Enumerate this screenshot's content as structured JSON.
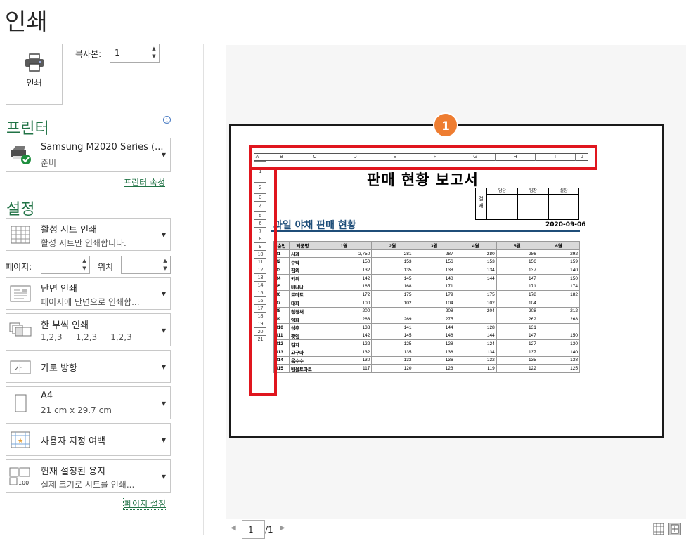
{
  "title": "인쇄",
  "print_button": {
    "label": "인쇄",
    "icon": "printer-icon"
  },
  "copies": {
    "label": "복사본:",
    "value": "1"
  },
  "printer_section": {
    "heading": "프린터",
    "info_icon": "info-icon"
  },
  "printer": {
    "name": "Samsung M2020 Series (...",
    "status": "준비",
    "properties_link": "프린터 속성"
  },
  "settings_section": {
    "heading": "설정"
  },
  "settings": [
    {
      "icon": "sheet-grid-icon",
      "line1": "활성 시트 인쇄",
      "line2": "활성 시트만 인쇄합니다."
    },
    {
      "icon": "one-sided-icon",
      "line1": "단면 인쇄",
      "line2": "페이지에 단면으로 인쇄합..."
    },
    {
      "icon": "collate-icon",
      "line1": "한 부씩 인쇄",
      "line2": "1,2,3     1,2,3     1,2,3"
    },
    {
      "icon": "orientation-icon",
      "line1": "가로 방향",
      "line2": ""
    },
    {
      "icon": "paper-size-icon",
      "line1": "A4",
      "line2": "21 cm x 29.7 cm"
    },
    {
      "icon": "margins-icon",
      "line1": "사용자 지정 여백",
      "line2": ""
    },
    {
      "icon": "scaling-icon",
      "line1": "현재 설정된 용지",
      "line2": "실제 크기로 시트를 인쇄..."
    }
  ],
  "pages": {
    "label": "페이지:",
    "to_label": "위치"
  },
  "page_setup_link": "페이지 설정",
  "badge": "1",
  "preview": {
    "col_headers": [
      "A",
      "B",
      "C",
      "D",
      "E",
      "F",
      "G",
      "H",
      "I",
      "J"
    ],
    "row_headers": [
      "1",
      "2",
      "3",
      "4",
      "5",
      "6",
      "7",
      "8",
      "9",
      "10",
      "11",
      "12",
      "13",
      "14",
      "15",
      "16",
      "17",
      "18",
      "19",
      "20",
      "21"
    ],
    "doc_title": "판매 현황 보고서",
    "approval": {
      "side": "결 재",
      "headers": [
        "담당",
        "팀장",
        "실장"
      ]
    },
    "subtitle": "과일 야채 판매 현황",
    "date": "2020-09-06",
    "table_headers": [
      "순번",
      "제품명",
      "1월",
      "2월",
      "3월",
      "4월",
      "5월",
      "6월"
    ],
    "table_rows": [
      [
        "01",
        "사과",
        "2,750",
        "281",
        "287",
        "280",
        "286",
        "292"
      ],
      [
        "02",
        "수박",
        "150",
        "153",
        "156",
        "153",
        "156",
        "159"
      ],
      [
        "03",
        "참외",
        "132",
        "135",
        "138",
        "134",
        "137",
        "140"
      ],
      [
        "04",
        "키위",
        "142",
        "145",
        "148",
        "144",
        "147",
        "150"
      ],
      [
        "05",
        "바나나",
        "165",
        "168",
        "171",
        "",
        "171",
        "174"
      ],
      [
        "06",
        "토마토",
        "172",
        "175",
        "179",
        "175",
        "178",
        "182"
      ],
      [
        "07",
        "대파",
        "100",
        "102",
        "104",
        "102",
        "104",
        ""
      ],
      [
        "08",
        "청경채",
        "200",
        "",
        "208",
        "204",
        "208",
        "212"
      ],
      [
        "09",
        "양파",
        "263",
        "269",
        "275",
        "",
        "262",
        "268"
      ],
      [
        "010",
        "상추",
        "138",
        "141",
        "144",
        "128",
        "131",
        ""
      ],
      [
        "011",
        "깻잎",
        "142",
        "145",
        "148",
        "144",
        "147",
        "150"
      ],
      [
        "012",
        "감자",
        "122",
        "125",
        "128",
        "124",
        "127",
        "130"
      ],
      [
        "013",
        "고구마",
        "132",
        "135",
        "138",
        "134",
        "137",
        "140"
      ],
      [
        "014",
        "옥수수",
        "130",
        "133",
        "136",
        "132",
        "135",
        "138"
      ],
      [
        "015",
        "방울토마토",
        "117",
        "120",
        "123",
        "119",
        "122",
        "125"
      ]
    ]
  },
  "pager": {
    "current": "1",
    "total": "/1"
  }
}
